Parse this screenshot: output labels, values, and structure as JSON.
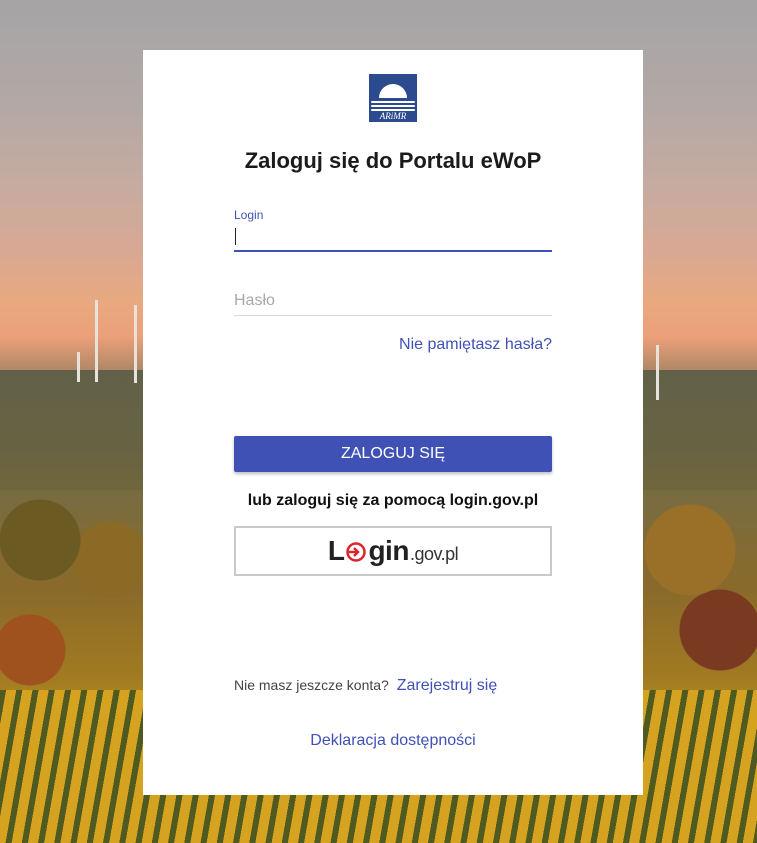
{
  "logo": {
    "brand": "ARiMR"
  },
  "title": "Zaloguj się do Portalu eWoP",
  "login_field": {
    "label": "Login",
    "value": ""
  },
  "password_field": {
    "placeholder": "Hasło",
    "value": ""
  },
  "forgot_password": "Nie pamiętasz hasła?",
  "submit_button": "ZALOGUJ SIĘ",
  "alternative_text": "lub zaloguj się za pomocą login.gov.pl",
  "login_gov_button": {
    "prefix": "L",
    "rest": "gin",
    "suffix": ".gov.pl"
  },
  "register": {
    "prompt": "Nie masz jeszcze konta?",
    "link": "Zarejestruj się"
  },
  "accessibility_link": "Deklaracja dostępności",
  "colors": {
    "accent": "#3f51b5",
    "login_gov_red": "#d9262c",
    "logo_blue": "#2c4b8e"
  }
}
